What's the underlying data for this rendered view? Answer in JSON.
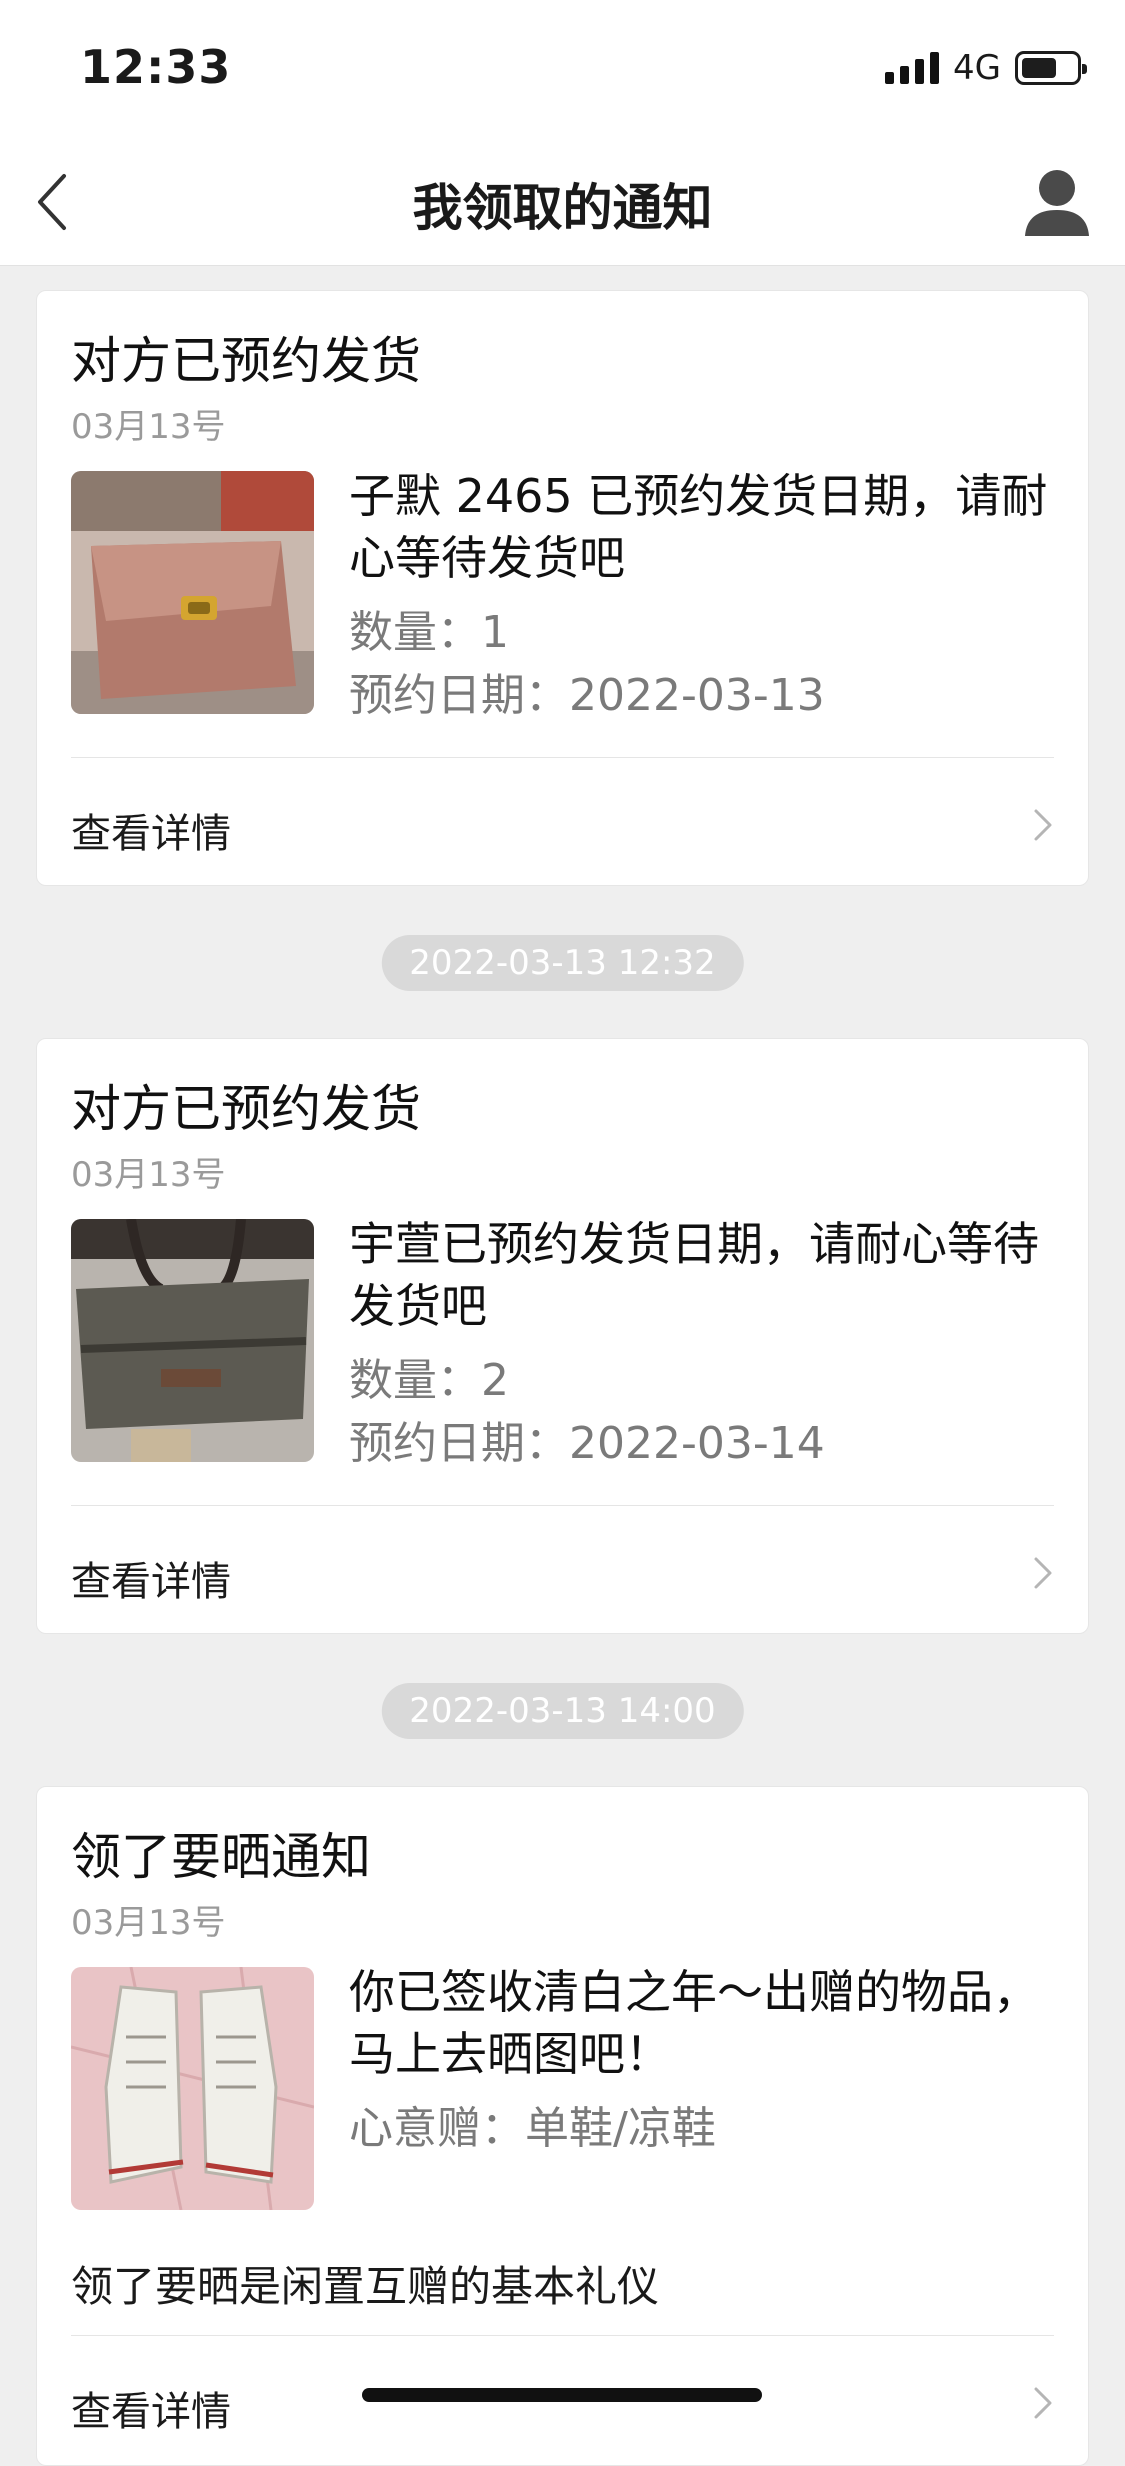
{
  "status_bar": {
    "time": "12:33",
    "network": "4G",
    "battery_level": 0.6
  },
  "nav": {
    "title": "我领取的通知",
    "back_icon": "chevron-left-icon",
    "profile_icon": "user-icon"
  },
  "cards": [
    {
      "title": "对方已预约发货",
      "date": "03月13号",
      "image_icon": "handbag-photo",
      "message": "子默 2465 已预约发货日期，请耐心等待发货吧",
      "quantity_label": "数量：1",
      "appointment_label": "预约日期：2022-03-13",
      "link_label": "查看详情"
    },
    {
      "title": "对方已预约发货",
      "date": "03月13号",
      "image_icon": "travel-bag-photo",
      "message": "宇萱已预约发货日期，请耐心等待发货吧",
      "quantity_label": "数量：2",
      "appointment_label": "预约日期：2022-03-14",
      "link_label": "查看详情"
    },
    {
      "title": "领了要晒通知",
      "date": "03月13号",
      "image_icon": "sneakers-photo",
      "message": "你已签收清白之年～出赠的物品，马上去晒图吧！",
      "category_label": "心意赠：单鞋/凉鞋",
      "note": "领了要晒是闲置互赠的基本礼仪",
      "link_label": "查看详情"
    }
  ],
  "timestamps": [
    "2022-03-13 12:32",
    "2022-03-13 14:00"
  ]
}
